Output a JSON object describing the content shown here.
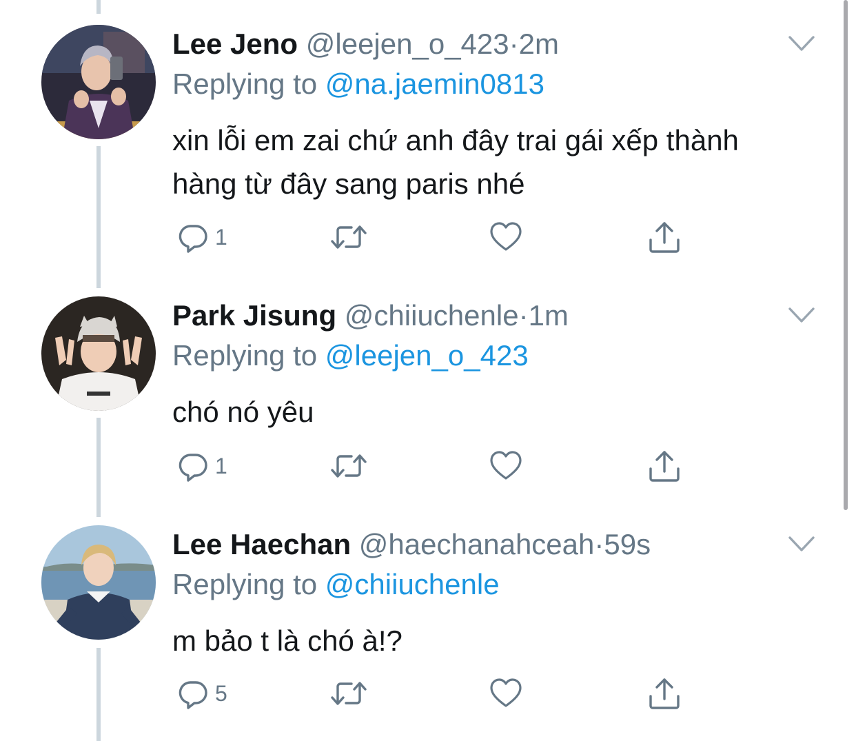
{
  "colors": {
    "text_primary": "#14171a",
    "text_secondary": "#657786",
    "link": "#1b95e0",
    "icon": "#657786",
    "thread_line": "#ccd6dd"
  },
  "tweets": [
    {
      "display_name": "Lee Jeno",
      "handle": "@leejen_o_423",
      "separator": "·",
      "time": "2m",
      "replying_prefix": "Replying to",
      "replying_to": "@na.jaemin0813",
      "text": "xin lỗi em zai chứ anh đây trai gái xếp thành hàng từ đây sang paris nhé",
      "reply_count": "1",
      "icons": {
        "reply": "reply-icon",
        "retweet": "retweet-icon",
        "like": "heart-icon",
        "share": "share-icon",
        "more": "chevron-down-icon"
      }
    },
    {
      "display_name": "Park Jisung",
      "handle": "@chiiuchenle",
      "separator": "·",
      "time": "1m",
      "replying_prefix": "Replying to",
      "replying_to": "@leejen_o_423",
      "text": "chó nó yêu",
      "reply_count": "1",
      "icons": {
        "reply": "reply-icon",
        "retweet": "retweet-icon",
        "like": "heart-icon",
        "share": "share-icon",
        "more": "chevron-down-icon"
      }
    },
    {
      "display_name": "Lee Haechan",
      "handle": "@haechanahceah",
      "separator": "·",
      "time": "59s",
      "replying_prefix": "Replying to",
      "replying_to": "@chiiuchenle",
      "text": "m bảo t là chó à!?",
      "reply_count": "5",
      "icons": {
        "reply": "reply-icon",
        "retweet": "retweet-icon",
        "like": "heart-icon",
        "share": "share-icon",
        "more": "chevron-down-icon"
      }
    }
  ]
}
